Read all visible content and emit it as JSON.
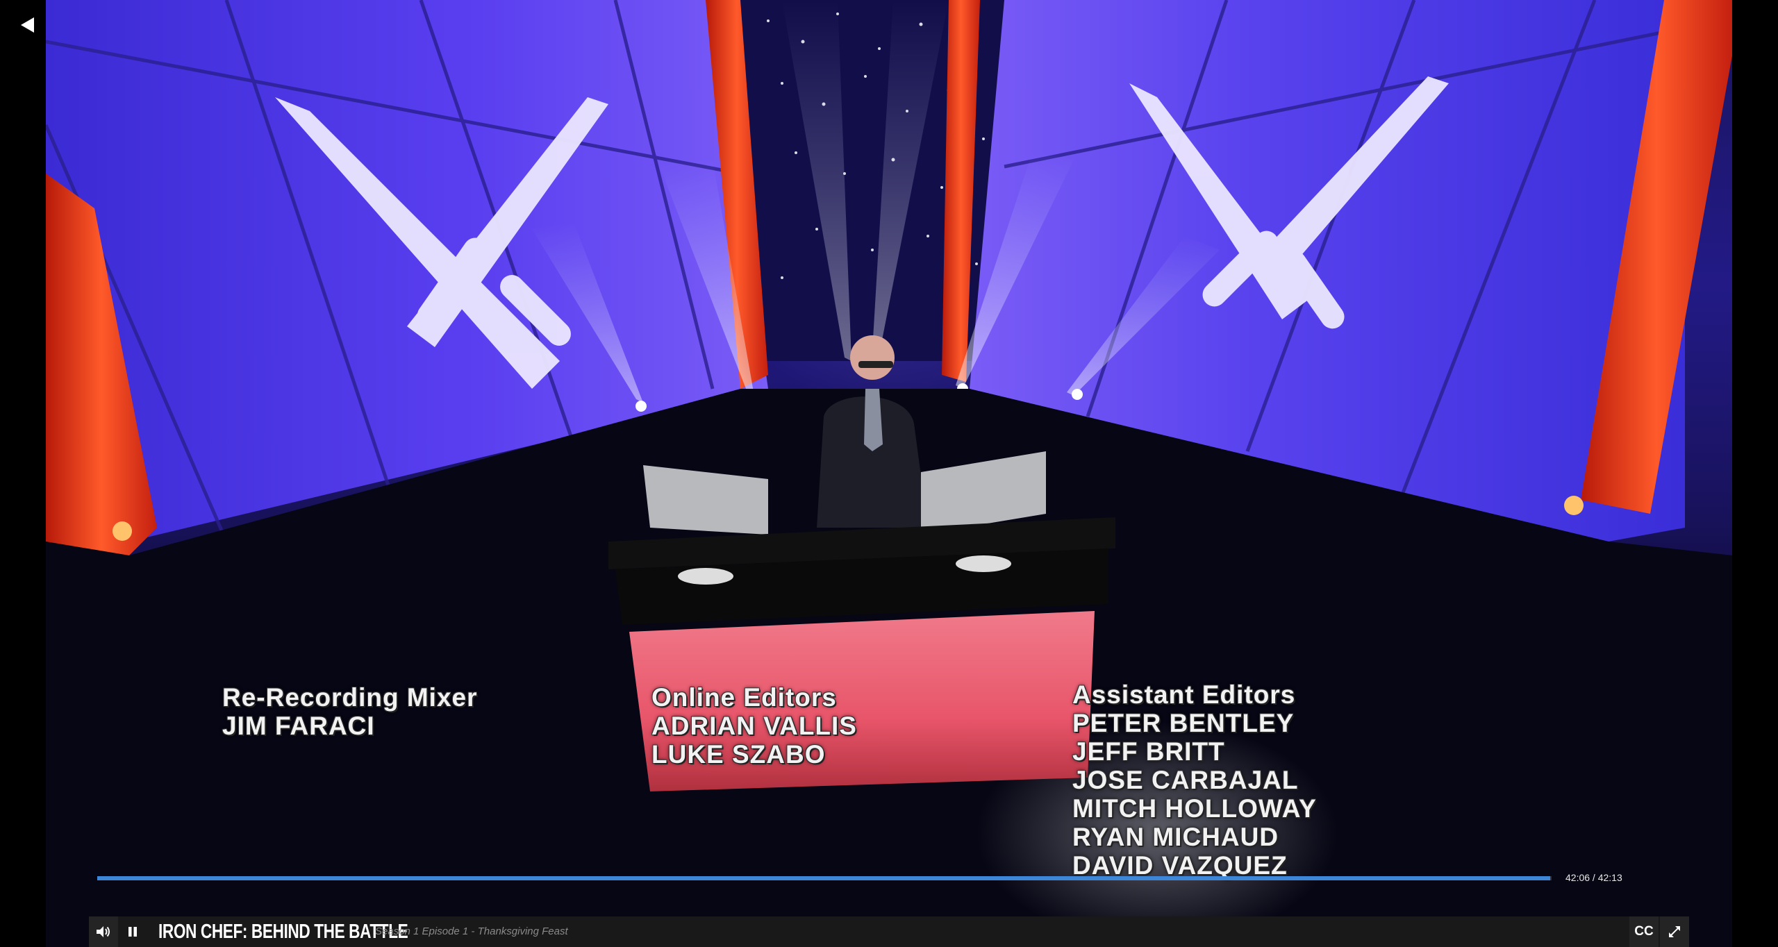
{
  "player": {
    "back_icon": "back-arrow-icon",
    "progress_fraction": 0.9992,
    "time_display": "42:06 / 42:13",
    "accent_color": "#3d86d8"
  },
  "controls": {
    "volume_icon": "volume-icon",
    "pause_icon": "pause-icon",
    "show_title": "IRON CHEF: BEHIND THE BATTLE",
    "episode": "Season 1 Episode 1 - Thanksgiving Feast",
    "cc_label": "CC",
    "fullscreen_icon": "fullscreen-icon"
  },
  "credits": {
    "mixer": {
      "role": "Re-Recording Mixer",
      "names": [
        "JIM FARACI"
      ]
    },
    "online": {
      "role": "Online Editors",
      "names": [
        "ADRIAN VALLIS",
        "LUKE SZABO"
      ]
    },
    "assistant": {
      "role": "Assistant Editors",
      "names": [
        "PETER BENTLEY",
        "JEFF BRITT",
        "JOSE CARBAJAL",
        "MITCH HOLLOWAY",
        "RYAN MICHAUD",
        "DAVID VAZQUEZ"
      ]
    }
  }
}
